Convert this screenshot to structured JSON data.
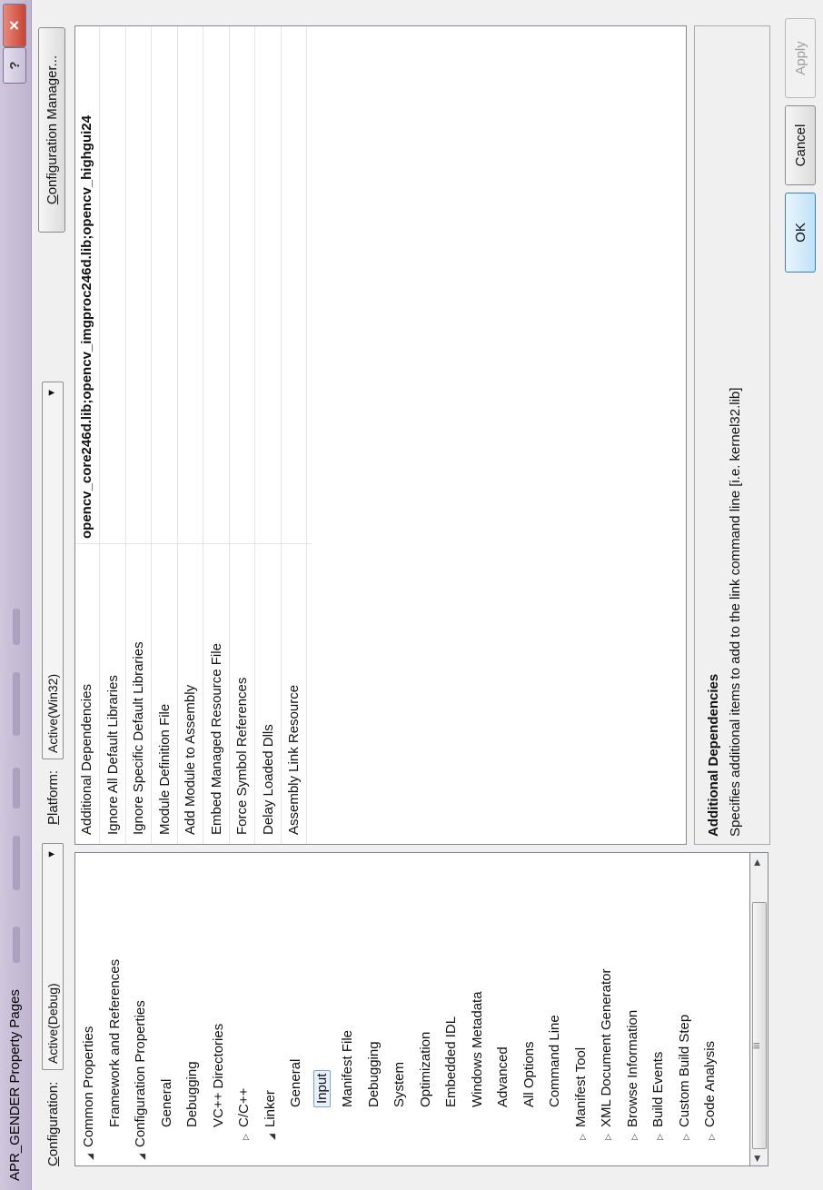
{
  "window": {
    "title": "APR_GENDER Property Pages",
    "help_glyph": "?",
    "close_glyph": "✕"
  },
  "config": {
    "configuration_label": "Configuration:",
    "configuration_value": "Active(Debug)",
    "platform_label": "Platform:",
    "platform_value": "Active(Win32)",
    "config_manager_label": "Configuration Manager..."
  },
  "tree": [
    {
      "label": "Common Properties",
      "level": 0,
      "expander": "expanded"
    },
    {
      "label": "Framework and References",
      "level": 1
    },
    {
      "label": "Configuration Properties",
      "level": 0,
      "expander": "expanded"
    },
    {
      "label": "General",
      "level": 1
    },
    {
      "label": "Debugging",
      "level": 1
    },
    {
      "label": "VC++ Directories",
      "level": 1
    },
    {
      "label": "C/C++",
      "level": 1,
      "expander": "collapsed"
    },
    {
      "label": "Linker",
      "level": 1,
      "expander": "expanded"
    },
    {
      "label": "General",
      "level": 2
    },
    {
      "label": "Input",
      "level": 2,
      "selected": true
    },
    {
      "label": "Manifest File",
      "level": 2
    },
    {
      "label": "Debugging",
      "level": 2
    },
    {
      "label": "System",
      "level": 2
    },
    {
      "label": "Optimization",
      "level": 2
    },
    {
      "label": "Embedded IDL",
      "level": 2
    },
    {
      "label": "Windows Metadata",
      "level": 2
    },
    {
      "label": "Advanced",
      "level": 2
    },
    {
      "label": "All Options",
      "level": 2
    },
    {
      "label": "Command Line",
      "level": 2
    },
    {
      "label": "Manifest Tool",
      "level": 1,
      "expander": "collapsed"
    },
    {
      "label": "XML Document Generator",
      "level": 1,
      "expander": "collapsed"
    },
    {
      "label": "Browse Information",
      "level": 1,
      "expander": "collapsed"
    },
    {
      "label": "Build Events",
      "level": 1,
      "expander": "collapsed"
    },
    {
      "label": "Custom Build Step",
      "level": 1,
      "expander": "collapsed"
    },
    {
      "label": "Code Analysis",
      "level": 1,
      "expander": "collapsed"
    }
  ],
  "tree_scrollbar": {
    "left_arrow": "◀",
    "right_arrow": "▶",
    "grip": "III"
  },
  "properties": [
    {
      "name": "Additional Dependencies",
      "value": "opencv_core246d.lib;opencv_imgproc246d.lib;opencv_highgui24"
    },
    {
      "name": "Ignore All Default Libraries",
      "value": ""
    },
    {
      "name": "Ignore Specific Default Libraries",
      "value": ""
    },
    {
      "name": "Module Definition File",
      "value": ""
    },
    {
      "name": "Add Module to Assembly",
      "value": ""
    },
    {
      "name": "Embed Managed Resource File",
      "value": ""
    },
    {
      "name": "Force Symbol References",
      "value": ""
    },
    {
      "name": "Delay Loaded Dlls",
      "value": ""
    },
    {
      "name": "Assembly Link Resource",
      "value": ""
    }
  ],
  "description": {
    "title": "Additional Dependencies",
    "text": "Specifies additional items to add to the link command line [i.e. kernel32.lib]"
  },
  "buttons": {
    "ok": "OK",
    "cancel": "Cancel",
    "apply": "Apply"
  },
  "colors": {
    "accent": "#bfe2f7",
    "titlebar": "#c8bed8",
    "close": "#c74431"
  }
}
